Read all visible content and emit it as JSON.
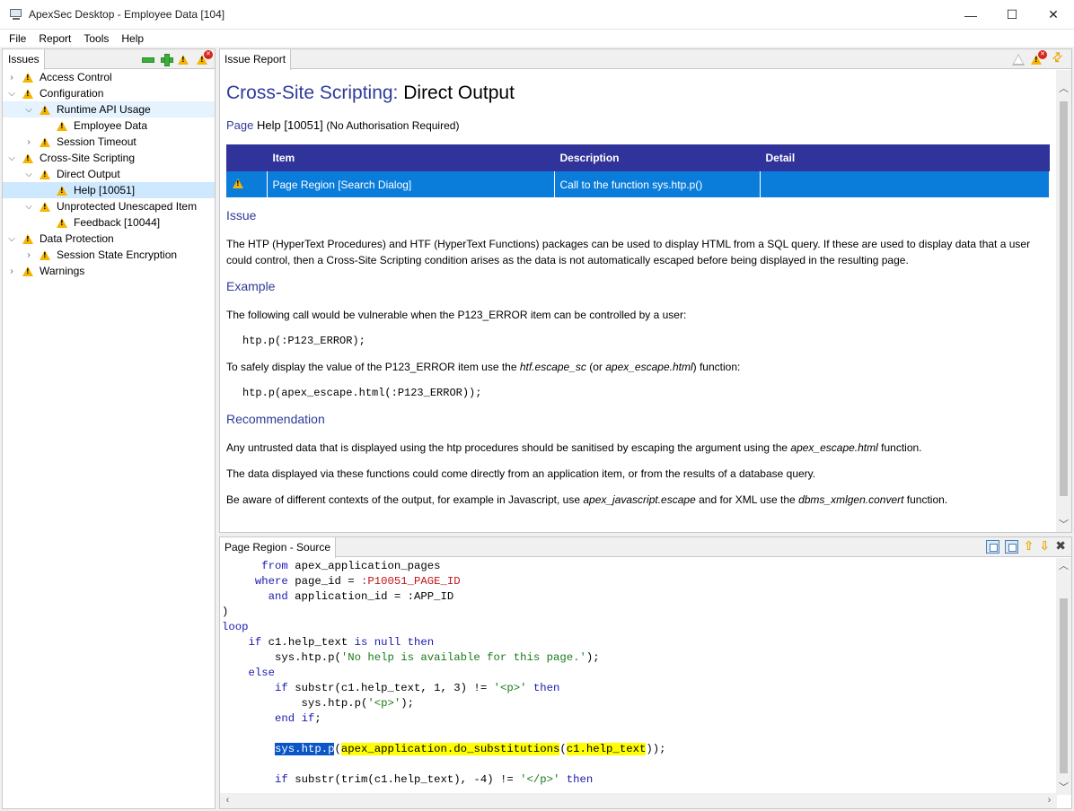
{
  "window": {
    "title": "ApexSec Desktop - Employee Data [104]",
    "controls": {
      "minimize": "—",
      "maximize": "☐",
      "close": "✕"
    }
  },
  "menu": [
    "File",
    "Report",
    "Tools",
    "Help"
  ],
  "issues_panel": {
    "tab_label": "Issues",
    "tree": [
      {
        "label": "Access Control",
        "level": 0,
        "expander": "›"
      },
      {
        "label": "Configuration",
        "level": 0,
        "expander": "⌄"
      },
      {
        "label": "Runtime API Usage",
        "level": 1,
        "expander": "⌄"
      },
      {
        "label": "Employee Data",
        "level": 2,
        "expander": ""
      },
      {
        "label": "Session Timeout",
        "level": 1,
        "expander": "›"
      },
      {
        "label": "Cross-Site Scripting",
        "level": 0,
        "expander": "⌄"
      },
      {
        "label": "Direct Output",
        "level": 1,
        "expander": "⌄"
      },
      {
        "label": "Help [10051]",
        "level": 2,
        "expander": ""
      },
      {
        "label": "Unprotected Unescaped Item",
        "level": 1,
        "expander": "⌄"
      },
      {
        "label": "Feedback [10044]",
        "level": 2,
        "expander": ""
      },
      {
        "label": "Data Protection",
        "level": 0,
        "expander": "⌄"
      },
      {
        "label": "Session State Encryption",
        "level": 1,
        "expander": "›"
      },
      {
        "label": "Warnings",
        "level": 0,
        "expander": "›"
      }
    ]
  },
  "report": {
    "tab_label": "Issue Report",
    "title_category": "Cross-Site Scripting:",
    "title_issue": "Direct Output",
    "page_word": "Page",
    "page_name": "Help [10051]",
    "page_auth": "(No Authorisation Required)",
    "table": {
      "headers": [
        "Item",
        "Description",
        "Detail"
      ],
      "rows": [
        {
          "item": "Page Region [Search Dialog]",
          "description": "Call to the function sys.htp.p()",
          "detail": ""
        }
      ]
    },
    "issue_heading": "Issue",
    "issue_text": "The HTP (HyperText Procedures) and HTF (HyperText Functions) packages can be used to display HTML from a SQL query. If these are used to display data that a user could control, then a Cross-Site Scripting condition arises as the data is not automatically escaped before being displayed in the resulting page.",
    "example_heading": "Example",
    "example_intro": "The following call would be vulnerable when the P123_ERROR item can be controlled by a user:",
    "example_code1": "htp.p(:P123_ERROR);",
    "example_safe_pre": "To safely display the value of the P123_ERROR item use the ",
    "example_safe_fn1": "htf.escape_sc",
    "example_safe_mid": " (or ",
    "example_safe_fn2": "apex_escape.html",
    "example_safe_post": ") function:",
    "example_code2": "htp.p(apex_escape.html(:P123_ERROR));",
    "recommendation_heading": "Recommendation",
    "rec1_pre": "Any untrusted data that is displayed using the htp procedures should be sanitised by escaping the argument using the ",
    "rec1_fn": "apex_escape.html",
    "rec1_post": " function.",
    "rec2": "The data displayed via these functions could come directly from an application item, or from the results of a database query.",
    "rec3_pre": "Be aware of different contexts of the output, for example in Javascript, use ",
    "rec3_fn1": "apex_javascript.escape",
    "rec3_mid": " and for XML use the ",
    "rec3_fn2": "dbms_xmlgen.convert",
    "rec3_post": " function."
  },
  "source": {
    "tab_label": "Page Region - Source",
    "lines": [
      [
        {
          "t": "      "
        },
        {
          "t": "from",
          "c": "kw"
        },
        {
          "t": " apex_application_pages"
        }
      ],
      [
        {
          "t": "     "
        },
        {
          "t": "where",
          "c": "kw"
        },
        {
          "t": " page_id = "
        },
        {
          "t": ":P10051_PAGE_ID",
          "c": "bind"
        }
      ],
      [
        {
          "t": "       "
        },
        {
          "t": "and",
          "c": "kw"
        },
        {
          "t": " application_id = :APP_ID"
        }
      ],
      [
        {
          "t": ")"
        }
      ],
      [
        {
          "t": "loop",
          "c": "kw"
        }
      ],
      [
        {
          "t": "    "
        },
        {
          "t": "if",
          "c": "kw"
        },
        {
          "t": " c1.help_text "
        },
        {
          "t": "is null then",
          "c": "kw"
        }
      ],
      [
        {
          "t": "        sys.htp.p("
        },
        {
          "t": "'No help is available for this page.'",
          "c": "str"
        },
        {
          "t": ");"
        }
      ],
      [
        {
          "t": "    "
        },
        {
          "t": "else",
          "c": "kw"
        }
      ],
      [
        {
          "t": "        "
        },
        {
          "t": "if",
          "c": "kw"
        },
        {
          "t": " substr(c1.help_text, 1, 3) != "
        },
        {
          "t": "'<p>'",
          "c": "str"
        },
        {
          "t": " "
        },
        {
          "t": "then",
          "c": "kw"
        }
      ],
      [
        {
          "t": "            sys.htp.p("
        },
        {
          "t": "'<p>'",
          "c": "str"
        },
        {
          "t": ");"
        }
      ],
      [
        {
          "t": "        "
        },
        {
          "t": "end if",
          "c": "kw"
        },
        {
          "t": ";"
        }
      ],
      [
        {
          "t": ""
        }
      ],
      [
        {
          "t": "        "
        },
        {
          "t": "sys.htp.p",
          "c": "hl-sel"
        },
        {
          "t": "("
        },
        {
          "t": "apex_application.do_substitutions",
          "c": "hl-y"
        },
        {
          "t": "("
        },
        {
          "t": "c1.help_text",
          "c": "hl-y"
        },
        {
          "t": "));"
        }
      ],
      [
        {
          "t": ""
        }
      ],
      [
        {
          "t": "        "
        },
        {
          "t": "if",
          "c": "kw"
        },
        {
          "t": " substr(trim(c1.help_text), -4) != "
        },
        {
          "t": "'</p>'",
          "c": "str"
        },
        {
          "t": " "
        },
        {
          "t": "then",
          "c": "kw"
        }
      ]
    ]
  }
}
